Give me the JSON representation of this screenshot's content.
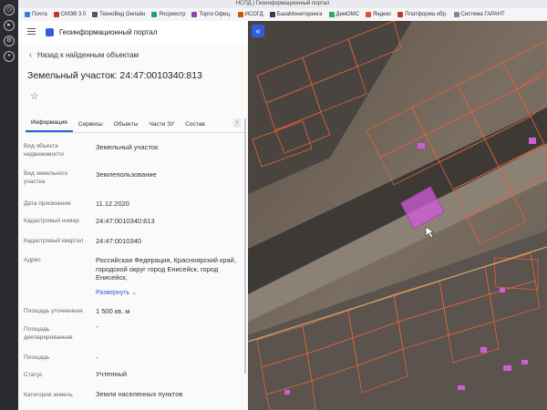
{
  "window": {
    "title": "НСПД | Геоинформационный портал"
  },
  "bookmarks": [
    {
      "label": "Почта",
      "color": "#2e86de"
    },
    {
      "label": "СМЭВ 3.0",
      "color": "#c0392b"
    },
    {
      "label": "ТехноВед Онлайн",
      "color": "#555555"
    },
    {
      "label": "Росреестр",
      "color": "#16a085"
    },
    {
      "label": "Торги Офиц.",
      "color": "#8e44ad"
    },
    {
      "label": "ИСОГД",
      "color": "#d35400"
    },
    {
      "label": "БазаМониторинга",
      "color": "#2c3e50"
    },
    {
      "label": "ДемОМС",
      "color": "#27ae60"
    },
    {
      "label": "Яндекс",
      "color": "#e74c3c"
    },
    {
      "label": "Платформа обр.",
      "color": "#c0392b"
    },
    {
      "label": "Система ГАРАНТ",
      "color": "#7f8c8d"
    }
  ],
  "header": {
    "title": "Геоинформационный портал"
  },
  "panel": {
    "back_label": "Назад к найденным объектам",
    "parcel_title": "Земельный участок: 24:47:0010340:813",
    "tabs": [
      "Информация",
      "Сервисы",
      "Объекты",
      "Части ЗУ",
      "Состав"
    ],
    "properties": [
      {
        "label": "Вид объекта недвижимости",
        "value": "Земельный участок"
      },
      {
        "label": "Вид земельного участка",
        "value": "Землепользование"
      },
      {
        "label": "Дата присвоения",
        "value": "11.12.2020"
      },
      {
        "label": "Кадастровый номер",
        "value": "24:47:0010340:813"
      },
      {
        "label": "Кадастровый квартал",
        "value": "24:47:0010340"
      },
      {
        "label": "Адрес",
        "value": "Российская Федерация, Красноярский край, городской округ город Енисейск, город Енисейск,",
        "expand": "Развернуть"
      },
      {
        "label": "Площадь уточненная",
        "value": "1 500 кв. м"
      },
      {
        "label": "Площадь декларированная",
        "value": "-"
      },
      {
        "label": "Площадь",
        "value": "-"
      },
      {
        "label": "Статус",
        "value": "Учтенный"
      },
      {
        "label": "Категория земель",
        "value": "Земли населенных пунктов"
      }
    ]
  },
  "map": {
    "collapse_label": "«"
  },
  "colors": {
    "accent": "#2e5fd8",
    "parcel_outline": "#e0643a",
    "selected_parcel": "#d05cd8"
  }
}
